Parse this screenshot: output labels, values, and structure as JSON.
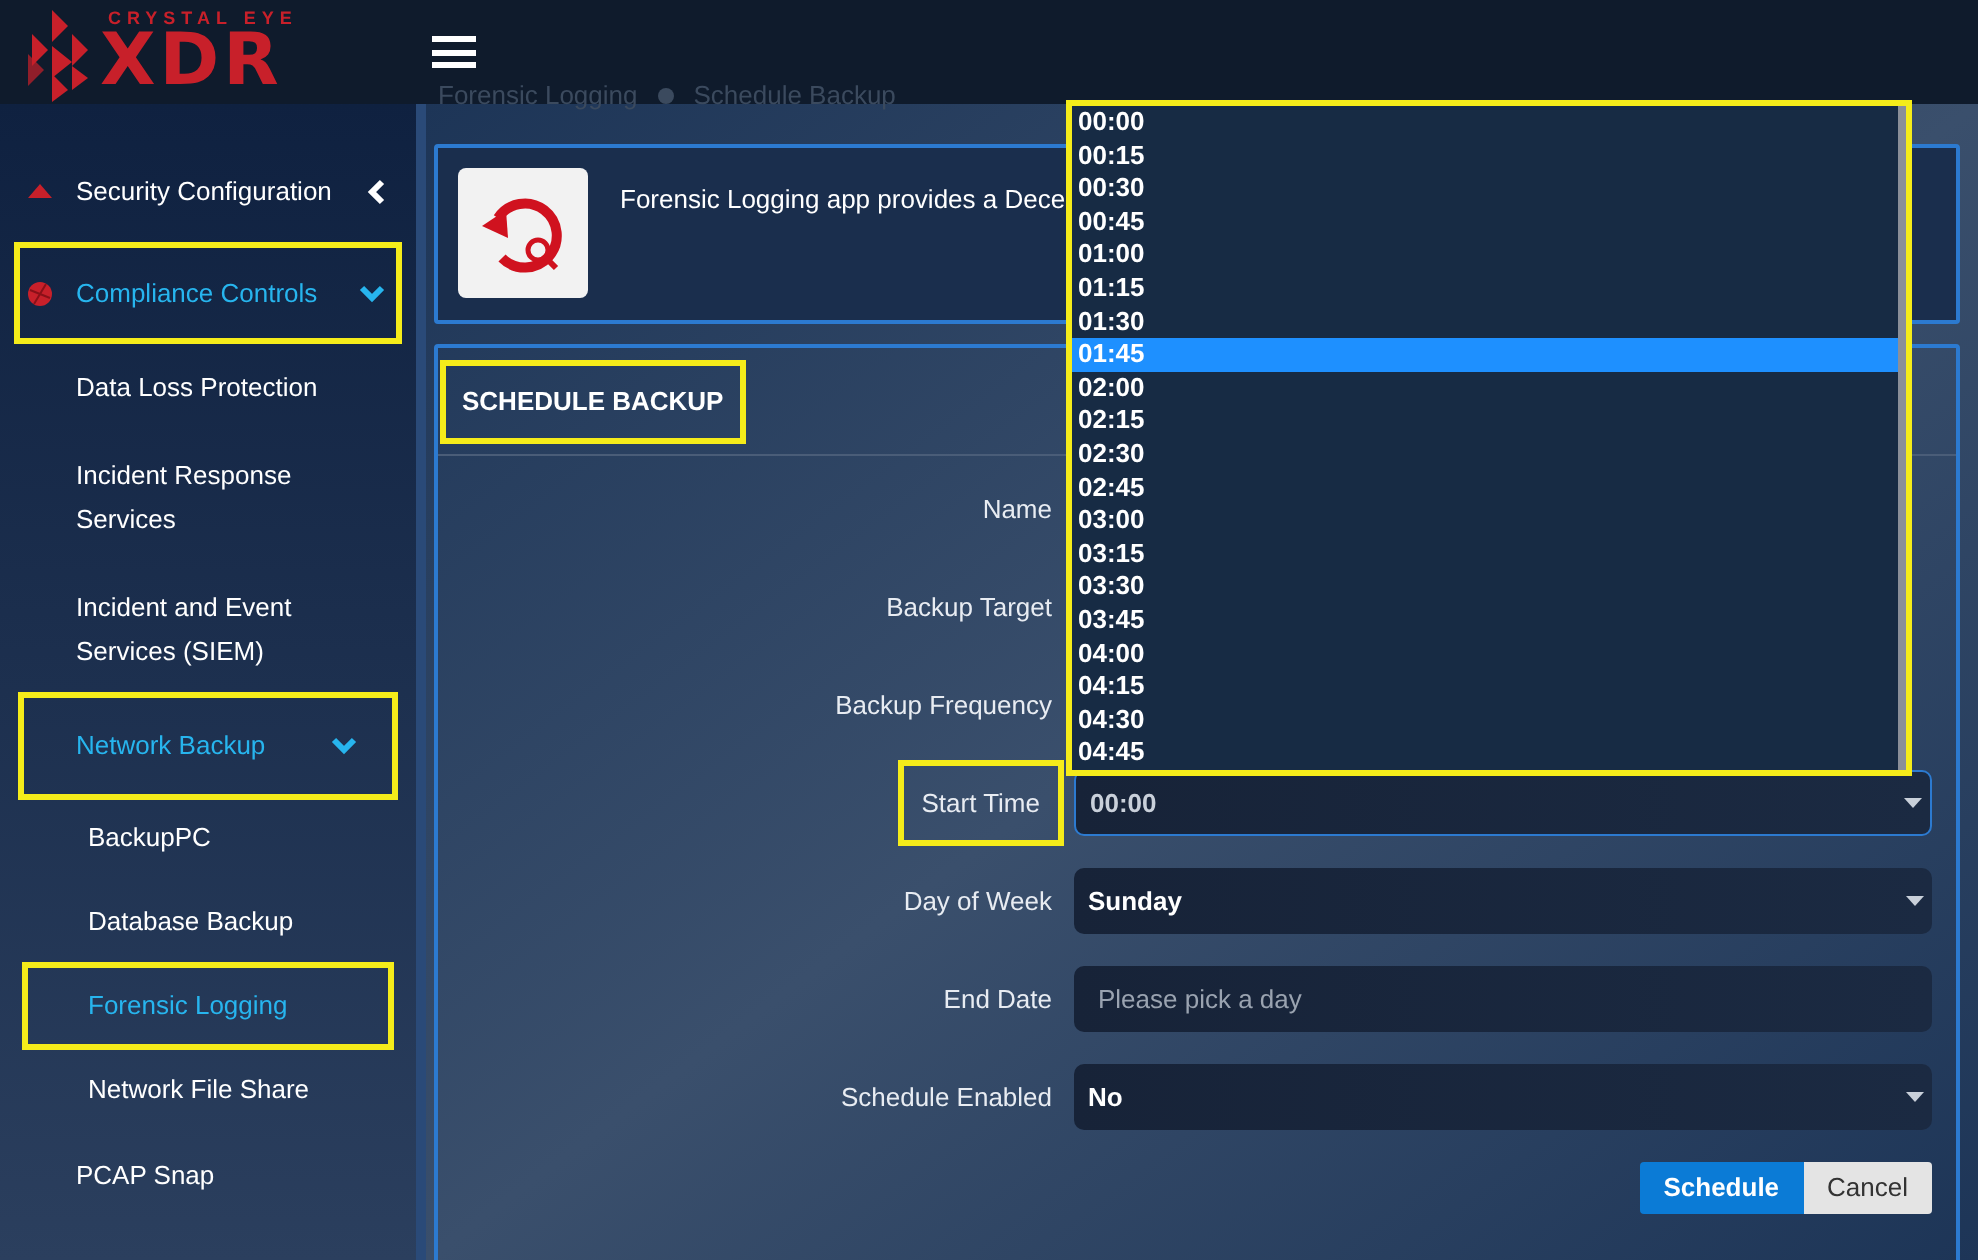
{
  "logo": {
    "tagline": "CRYSTAL EYE",
    "wordmark": "XDR"
  },
  "breadcrumb": [
    "Forensic Logging",
    "Schedule Backup"
  ],
  "sidebar": {
    "items": [
      {
        "label": "Security Configuration",
        "expanded": false,
        "selected": false,
        "highlighted": false
      },
      {
        "label": "Compliance Controls",
        "expanded": true,
        "selected": true,
        "highlighted": true,
        "children": [
          {
            "label": "Data Loss Protection",
            "selected": false,
            "highlighted": false
          },
          {
            "label": "Incident Response Services",
            "selected": false,
            "highlighted": false
          },
          {
            "label": "Incident and Event Services (SIEM)",
            "selected": false,
            "highlighted": false
          },
          {
            "label": "Network Backup",
            "expanded": true,
            "selected": true,
            "highlighted": true,
            "children": [
              {
                "label": "BackupPC",
                "selected": false,
                "highlighted": false
              },
              {
                "label": "Database Backup",
                "selected": false,
                "highlighted": false
              },
              {
                "label": "Forensic Logging",
                "selected": true,
                "highlighted": true
              },
              {
                "label": "Network File Share",
                "selected": false,
                "highlighted": false
              }
            ]
          },
          {
            "label": "PCAP Snap",
            "selected": false,
            "highlighted": false
          }
        ]
      }
    ]
  },
  "info_panel": {
    "text": "Forensic Logging app provides a Dece"
  },
  "form": {
    "title": "SCHEDULE BACKUP",
    "title_highlighted": true,
    "fields": [
      {
        "label": "Name",
        "kind": "hidden",
        "highlighted": false
      },
      {
        "label": "Backup Target",
        "kind": "hidden",
        "highlighted": false
      },
      {
        "label": "Backup Frequency",
        "kind": "hidden",
        "highlighted": false
      },
      {
        "label": "Start Time",
        "kind": "select",
        "value": "00:00",
        "focused": true,
        "highlighted": true
      },
      {
        "label": "Day of Week",
        "kind": "select",
        "value": "Sunday",
        "highlighted": false
      },
      {
        "label": "End Date",
        "kind": "date",
        "placeholder": "Please pick a day",
        "highlighted": false
      },
      {
        "label": "Schedule Enabled",
        "kind": "select",
        "value": "No",
        "highlighted": false
      }
    ],
    "buttons": [
      {
        "label": "Schedule",
        "kind": "primary"
      },
      {
        "label": "Cancel",
        "kind": "secondary"
      }
    ]
  },
  "dropdown": {
    "highlighted": true,
    "options": [
      {
        "label": "00:00",
        "selected": false
      },
      {
        "label": "00:15",
        "selected": false
      },
      {
        "label": "00:30",
        "selected": false
      },
      {
        "label": "00:45",
        "selected": false
      },
      {
        "label": "01:00",
        "selected": false
      },
      {
        "label": "01:15",
        "selected": false
      },
      {
        "label": "01:30",
        "selected": false
      },
      {
        "label": "01:45",
        "selected": true
      },
      {
        "label": "02:00",
        "selected": false
      },
      {
        "label": "02:15",
        "selected": false
      },
      {
        "label": "02:30",
        "selected": false
      },
      {
        "label": "02:45",
        "selected": false
      },
      {
        "label": "03:00",
        "selected": false
      },
      {
        "label": "03:15",
        "selected": false
      },
      {
        "label": "03:30",
        "selected": false
      },
      {
        "label": "03:45",
        "selected": false
      },
      {
        "label": "04:00",
        "selected": false
      },
      {
        "label": "04:15",
        "selected": false
      },
      {
        "label": "04:30",
        "selected": false
      },
      {
        "label": "04:45",
        "selected": false
      }
    ]
  }
}
